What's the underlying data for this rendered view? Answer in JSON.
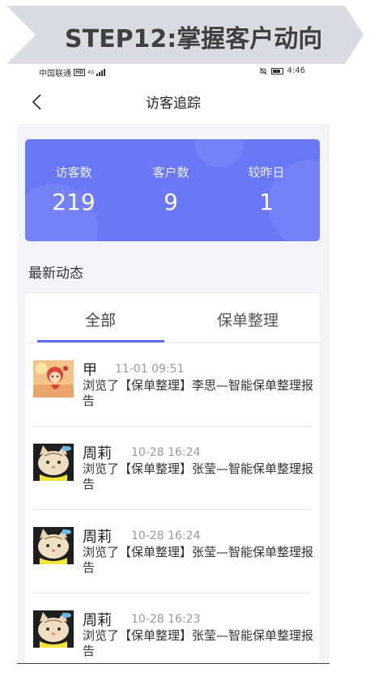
{
  "banner": {
    "title": "STEP12:掌握客户动向"
  },
  "statusbar": {
    "carrier": "中国联通",
    "hd": "HD",
    "network": "4G",
    "time": "4:46"
  },
  "navbar": {
    "title": "访客追踪"
  },
  "stats": [
    {
      "label": "访客数",
      "value": "219"
    },
    {
      "label": "客户数",
      "value": "9"
    },
    {
      "label": "较昨日",
      "value": "1"
    }
  ],
  "section_title": "最新动态",
  "tabs": [
    {
      "label": "全部",
      "active": true
    },
    {
      "label": "保单整理",
      "active": false
    }
  ],
  "items": [
    {
      "name": "甲",
      "time": "11-01 09:51",
      "desc": "浏览了【保单整理】李思—智能保单整理报告",
      "avatar": "cartoon-girl"
    },
    {
      "name": "周莉",
      "time": "10-28 16:24",
      "desc": "浏览了【保单整理】张莹—智能保单整理报告",
      "avatar": "cat"
    },
    {
      "name": "周莉",
      "time": "10-28 16:24",
      "desc": "浏览了【保单整理】张莹—智能保单整理报告",
      "avatar": "cat"
    },
    {
      "name": "周莉",
      "time": "10-28 16:23",
      "desc": "浏览了【保单整理】张莹—智能保单整理报告",
      "avatar": "cat"
    }
  ],
  "colors": {
    "accent": "#6a78f7",
    "tab_indicator": "#5d6cf0",
    "banner_bg": "#d9dde3"
  }
}
